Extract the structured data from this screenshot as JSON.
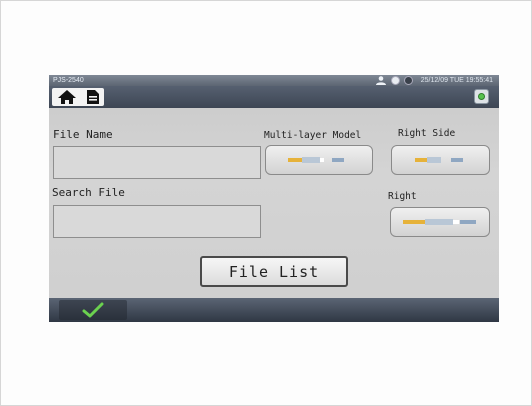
{
  "status_bar": {
    "model": "PJS-2540",
    "datetime": "25/12/09 TUE  19:55:41"
  },
  "icons": {
    "user": "user-icon",
    "home": "home-icon",
    "file": "file-icon",
    "power": "power-icon",
    "confirm": "checkmark-icon"
  },
  "form": {
    "file_name_label": "File Name",
    "search_file_label": "Search File",
    "file_name_value": "",
    "search_file_value": ""
  },
  "cable_options": {
    "multi_layer_label": "Multi-layer Model",
    "right_side_label": "Right Side",
    "right_label": "Right"
  },
  "buttons": {
    "file_list": "File List"
  },
  "colors": {
    "bar_dark": "#3d4654",
    "screen_bg": "#cfcfcf",
    "confirm_green": "#6bd14f",
    "cable_gold": "#e6b23a"
  }
}
